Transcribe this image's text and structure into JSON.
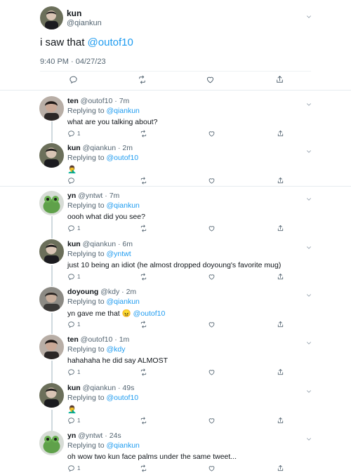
{
  "main_tweet": {
    "name": "kun",
    "handle": "@qiankun",
    "text_prefix": "i saw that ",
    "mention": "@outof10",
    "meta": "9:40 PM · 04/27/23"
  },
  "replies": [
    {
      "name": "ten",
      "handle": "@outof10",
      "time": "7m",
      "replying_prefix": "Replying to ",
      "replying_to": "@qiankun",
      "body": "what are you talking about?",
      "reply_count": "1"
    },
    {
      "name": "kun",
      "handle": "@qiankun",
      "time": "2m",
      "replying_prefix": "Replying to ",
      "replying_to": "@outof10",
      "body": "🤦‍♂️",
      "reply_count": ""
    },
    {
      "name": "yn",
      "handle": "@yntwt",
      "time": "7m",
      "replying_prefix": "Replying to ",
      "replying_to": "@qiankun",
      "body": "oooh what did you see?",
      "reply_count": "1"
    },
    {
      "name": "kun",
      "handle": "@qiankun",
      "time": "6m",
      "replying_prefix": "Replying to ",
      "replying_to": "@yntwt",
      "body": "just 10 being an idiot (he almost dropped doyoung's favorite mug)",
      "reply_count": "1"
    },
    {
      "name": "doyoung",
      "handle": "@kdy",
      "time": "2m",
      "replying_prefix": "Replying to ",
      "replying_to": "@qiankun",
      "body": "yn gave me that 😠 ",
      "body_mention": "@outof10",
      "reply_count": "1"
    },
    {
      "name": "ten",
      "handle": "@outof10",
      "time": "1m",
      "replying_prefix": "Replying to ",
      "replying_to": "@kdy",
      "body": "hahahaha he did say ALMOST",
      "reply_count": "1"
    },
    {
      "name": "kun",
      "handle": "@qiankun",
      "time": "49s",
      "replying_prefix": "Replying to ",
      "replying_to": "@outof10",
      "body": "🤦‍♂️",
      "reply_count": "1"
    },
    {
      "name": "yn",
      "handle": "@yntwt",
      "time": "24s",
      "replying_prefix": "Replying to ",
      "replying_to": "@qiankun",
      "body": "oh wow two kun face palms under the same tweet...",
      "reply_count": "1"
    }
  ],
  "colors": {
    "link": "#1d9bf0",
    "muted": "#536471",
    "text": "#0f1419",
    "divider": "#e6ecf0"
  },
  "icons": [
    "comment-icon",
    "retweet-icon",
    "like-icon",
    "share-icon",
    "chevron-down-icon"
  ]
}
